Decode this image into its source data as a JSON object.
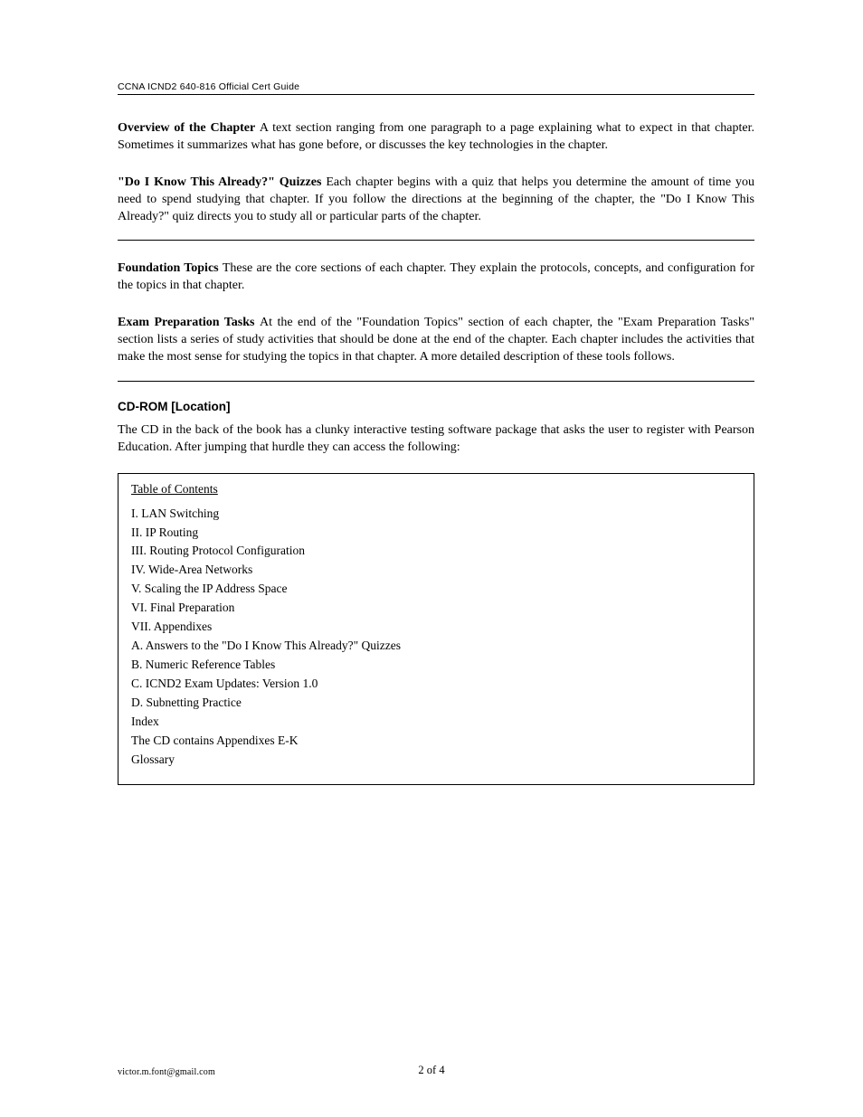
{
  "header": {
    "running_title": "CCNA ICND2 640-816 Official Cert Guide"
  },
  "section1": {
    "heading_bold": "Overview of the Chapter ",
    "heading_rest": "A text section ranging from one paragraph to ",
    "line2": "a page explaining what to expect in that chapter. Sometimes it summarizes what has gone before, or discusses the key technologies in the chapter."
  },
  "section2": {
    "label_bold": "\"Do I Know This Already?\" Quizzes ",
    "label_rest": "Each chapter begins with a quiz that",
    "line2": "helps you determine the amount of time you need to spend studying that chapter. If you follow the directions at the beginning of the chapter, the \"Do I Know This Already?\" quiz directs you to study all or particular parts of the chapter."
  },
  "section3": {
    "label_bold": "Foundation Topics ",
    "label_rest": "These are the core sections of each chapter. They",
    "line2": "explain the protocols, concepts, and configuration for the topics in that chapter."
  },
  "section4": {
    "label_bold": "Exam Preparation Tasks ",
    "label_rest": "At the end of the \"Foundation Topics\"",
    "line2": "section of each chapter, the \"Exam Preparation Tasks\" section lists a series of study activities that should be done at the end of the chapter. Each chapter includes the activities that make the most sense for studying the topics in that chapter. A more detailed description of these tools follows."
  },
  "item_heading": "CD-ROM [Location]",
  "item_para": "The CD in the back of the book has a clunky interactive testing software package that asks the user to register with Pearson Education. After jumping that hurdle they can access the following:",
  "toc": {
    "title": "Table of Contents",
    "items": [
      "I.   LAN Switching",
      "II.  IP Routing",
      "III. Routing Protocol Configuration",
      "IV. Wide-Area Networks",
      "V.  Scaling the IP Address Space",
      "VI. Final Preparation",
      "VII. Appendixes",
      "A. Answers to the \"Do I Know This Already?\" Quizzes",
      "B. Numeric Reference Tables",
      "C. ICND2 Exam Updates: Version 1.0",
      "D. Subnetting Practice",
      "Index",
      "The CD contains Appendixes E-K",
      "Glossary"
    ]
  },
  "footer": {
    "left": "victor.m.font@gmail.com",
    "page_number": "2 of 4"
  }
}
